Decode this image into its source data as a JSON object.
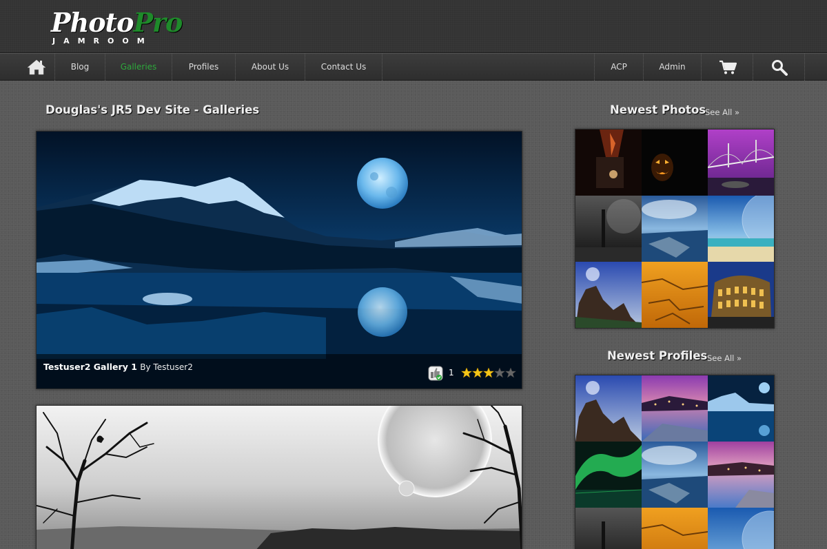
{
  "header": {
    "logo": {
      "word1": "Photo",
      "word2": "Pro",
      "sub": "JAMROOM"
    }
  },
  "nav": {
    "home_icon": "home-icon",
    "items": [
      {
        "label": "Blog",
        "active": false
      },
      {
        "label": "Galleries",
        "active": true
      },
      {
        "label": "Profiles",
        "active": false
      },
      {
        "label": "About Us",
        "active": false
      },
      {
        "label": "Contact Us",
        "active": false
      }
    ],
    "right_items": [
      {
        "label": "ACP"
      },
      {
        "label": "Admin"
      }
    ],
    "cart_icon": "cart-icon",
    "search_icon": "search-icon",
    "active_color": "#2ea83c"
  },
  "main": {
    "title": "Douglas's JR5 Dev Site - Galleries",
    "galleries": [
      {
        "title": "Testuser2 Gallery 1",
        "by": "By Testuser2",
        "likes": "1",
        "rating": 3,
        "rating_max": 5,
        "image": "night mountain lake with full moon"
      },
      {
        "image": "black and white trees with giant moon"
      }
    ]
  },
  "sidebar": {
    "newest_photos": {
      "title": "Newest Photos",
      "see_all": "See All »",
      "thumbs": [
        "fire night",
        "jack-o-lantern",
        "purple bridge",
        "dark pole",
        "blue rocky sea",
        "planet over beach",
        "rock towers",
        "orange cracked desert",
        "colosseum night"
      ]
    },
    "newest_profiles": {
      "title": "Newest Profiles",
      "see_all": "See All »",
      "thumbs": [
        "rock towers",
        "purple coastal town",
        "moon lake",
        "aurora",
        "blue rocky sea",
        "coastal town",
        "dark pole",
        "orange desert",
        "planet over beach"
      ]
    }
  }
}
